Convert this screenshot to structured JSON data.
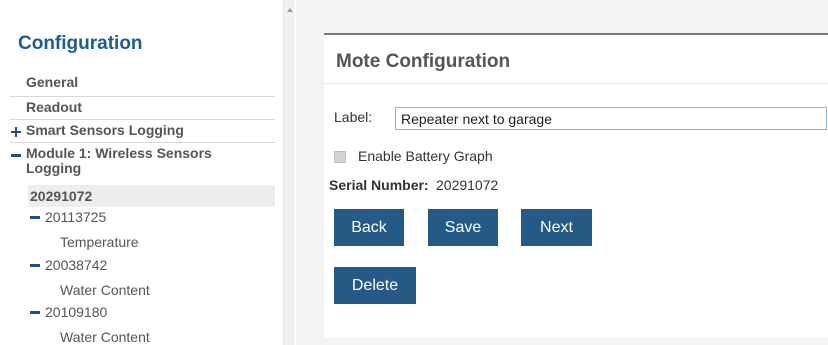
{
  "sidebar": {
    "title": "Configuration",
    "items": {
      "general": "General",
      "readout": "Readout",
      "smart_sensors": "Smart Sensors Logging",
      "module1": "Module 1: Wireless Sensors Logging",
      "selected": "20291072",
      "sub1": "20113725",
      "sub1_leaf": "Temperature",
      "sub2": "20038742",
      "sub2_leaf": "Water Content",
      "sub3": "20109180",
      "sub3_leaf": "Water Content"
    }
  },
  "main": {
    "panel_title": "Mote Configuration",
    "label_field": {
      "label": "Label:",
      "value": "Repeater next to garage"
    },
    "battery_graph": {
      "label": "Enable Battery Graph",
      "checked": false
    },
    "serial": {
      "label": "Serial Number:",
      "value": "20291072"
    },
    "buttons": {
      "back": "Back",
      "save": "Save",
      "next": "Next",
      "delete": "Delete"
    }
  },
  "colors": {
    "accent": "#255a87",
    "title": "#1f5b8c"
  }
}
